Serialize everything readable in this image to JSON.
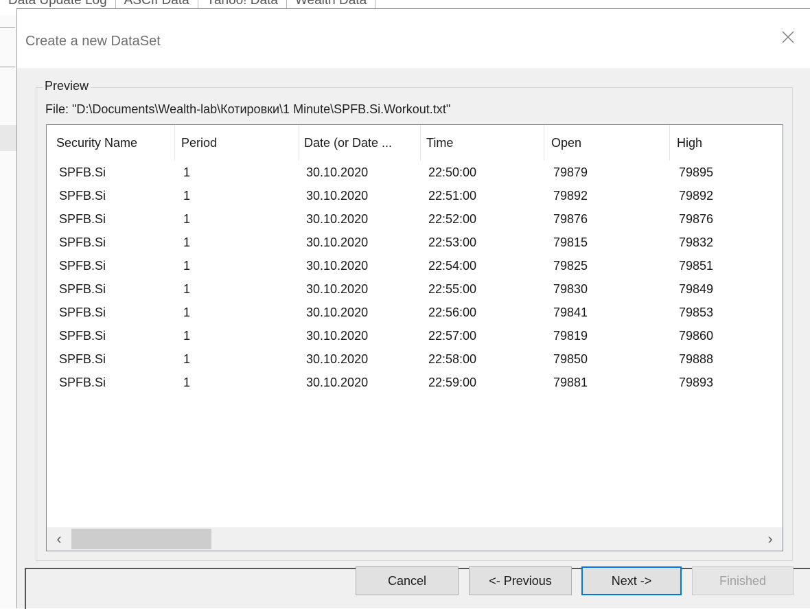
{
  "background_app": {
    "tabs": [
      "Data Update Log",
      "ASCII Data",
      "Yahoo! Data",
      "Wealth Data"
    ]
  },
  "dialog": {
    "title": "Create a new DataSet",
    "close_icon": "close-icon",
    "preview": {
      "group_label": "Preview",
      "file_label": "File: \"D:\\Documents\\Wealth-lab\\Котировки\\1 Minute\\SPFB.Si.Workout.txt\""
    },
    "table": {
      "columns": [
        "Security Name",
        "Period",
        "Date (or Date ...",
        "Time",
        "Open",
        "High"
      ],
      "rows": [
        [
          "SPFB.Si",
          "1",
          "30.10.2020",
          "22:50:00",
          "79879",
          "79895"
        ],
        [
          "SPFB.Si",
          "1",
          "30.10.2020",
          "22:51:00",
          "79892",
          "79892"
        ],
        [
          "SPFB.Si",
          "1",
          "30.10.2020",
          "22:52:00",
          "79876",
          "79876"
        ],
        [
          "SPFB.Si",
          "1",
          "30.10.2020",
          "22:53:00",
          "79815",
          "79832"
        ],
        [
          "SPFB.Si",
          "1",
          "30.10.2020",
          "22:54:00",
          "79825",
          "79851"
        ],
        [
          "SPFB.Si",
          "1",
          "30.10.2020",
          "22:55:00",
          "79830",
          "79849"
        ],
        [
          "SPFB.Si",
          "1",
          "30.10.2020",
          "22:56:00",
          "79841",
          "79853"
        ],
        [
          "SPFB.Si",
          "1",
          "30.10.2020",
          "22:57:00",
          "79819",
          "79860"
        ],
        [
          "SPFB.Si",
          "1",
          "30.10.2020",
          "22:58:00",
          "79850",
          "79888"
        ],
        [
          "SPFB.Si",
          "1",
          "30.10.2020",
          "22:59:00",
          "79881",
          "79893"
        ]
      ],
      "scroll_left_glyph": "‹",
      "scroll_right_glyph": "›"
    },
    "buttons": {
      "cancel": "Cancel",
      "previous": "<- Previous",
      "next": "Next ->",
      "finished": "Finished"
    }
  }
}
